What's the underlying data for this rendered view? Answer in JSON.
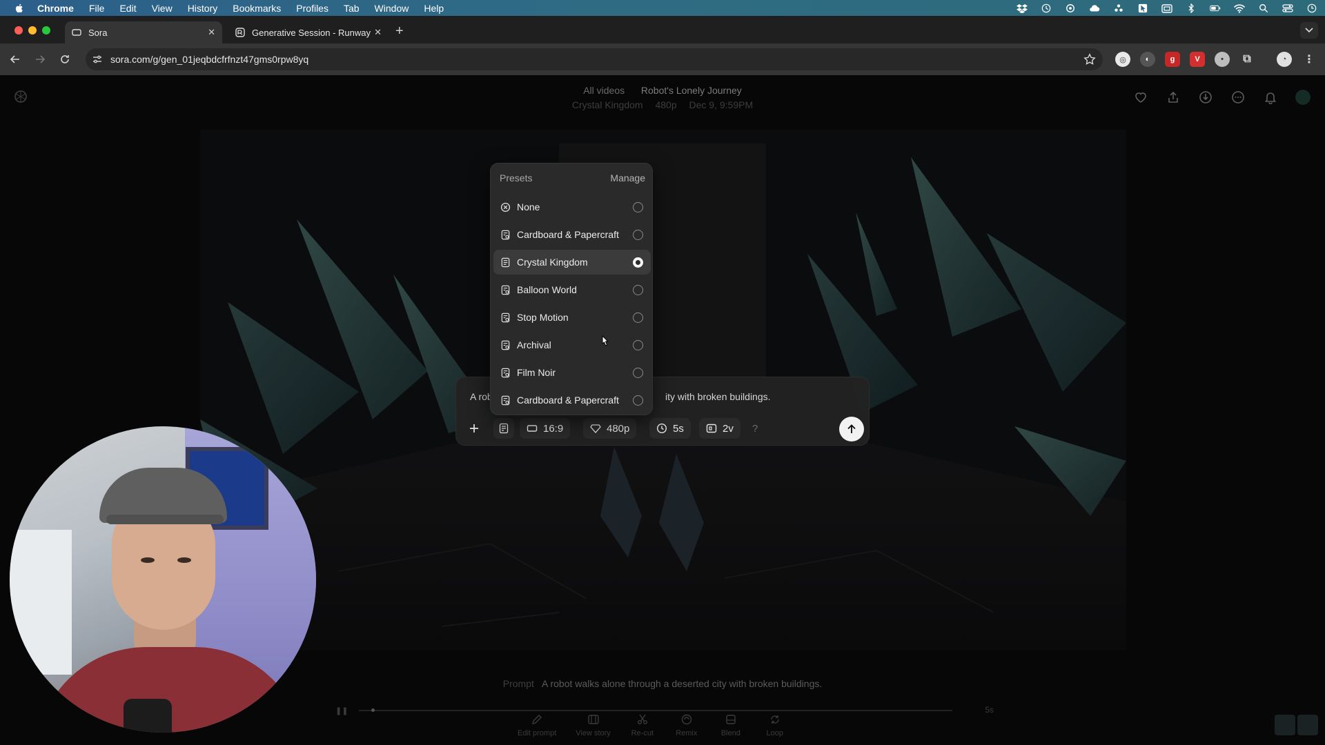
{
  "menubar": {
    "app": "Chrome",
    "items": [
      "File",
      "Edit",
      "View",
      "History",
      "Bookmarks",
      "Profiles",
      "Tab",
      "Window",
      "Help"
    ]
  },
  "tabs": [
    {
      "title": "Sora",
      "active": true
    },
    {
      "title": "Generative Session - Runway",
      "active": false
    }
  ],
  "address": {
    "url": "sora.com/g/gen_01jeqbdcfrfnzt47gms0rpw8yq"
  },
  "header": {
    "crumb_root": "All videos",
    "crumb_current": "Robot's Lonely Journey",
    "meta": [
      "Crystal Kingdom",
      "480p",
      "Dec 9, 9:59PM"
    ]
  },
  "presets": {
    "title": "Presets",
    "manage_label": "Manage",
    "items": [
      {
        "label": "None",
        "icon": "no-preset-icon",
        "selected": false
      },
      {
        "label": "Cardboard & Papercraft",
        "icon": "preset-icon",
        "selected": false
      },
      {
        "label": "Crystal Kingdom",
        "icon": "preset-icon",
        "selected": true
      },
      {
        "label": "Balloon World",
        "icon": "preset-icon",
        "selected": false
      },
      {
        "label": "Stop Motion",
        "icon": "preset-icon",
        "selected": false
      },
      {
        "label": "Archival",
        "icon": "preset-icon",
        "selected": false
      },
      {
        "label": "Film Noir",
        "icon": "preset-icon",
        "selected": false
      },
      {
        "label": "Cardboard & Papercraft",
        "icon": "preset-icon",
        "selected": false
      }
    ]
  },
  "composer": {
    "prompt_start": "A rob",
    "prompt_end": "ity with broken buildings.",
    "aspect": "16:9",
    "resolution": "480p",
    "duration": "5s",
    "variations": "2v",
    "help": "?"
  },
  "bottom": {
    "prompt_label": "Prompt",
    "prompt_text": "A robot walks alone through a deserted city with broken buildings.",
    "duration": "5s",
    "actions": [
      "Edit prompt",
      "View story",
      "Re-cut",
      "Remix",
      "Blend",
      "Loop"
    ]
  },
  "colors": {
    "menubar": "#2f6c84",
    "tabstrip": "#1f1f1f",
    "toolbar": "#353535",
    "page_bg": "#070707",
    "dropdown_bg": "#2a2a2a",
    "send_button": "#f2f2f2"
  }
}
